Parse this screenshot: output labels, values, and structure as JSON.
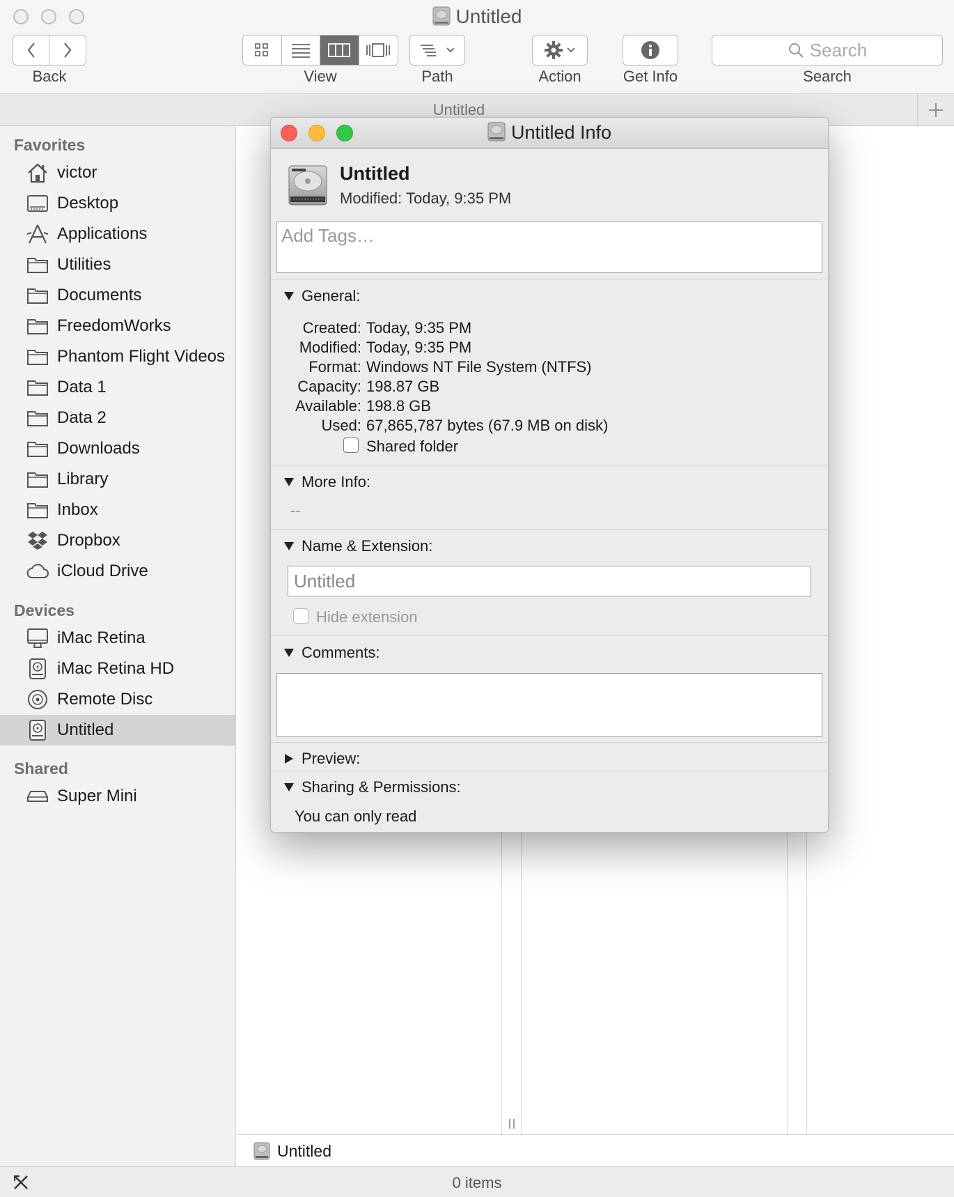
{
  "window": {
    "title": "Untitled"
  },
  "toolbar": {
    "back_label": "Back",
    "view_label": "View",
    "path_label": "Path",
    "action_label": "Action",
    "getinfo_label": "Get Info",
    "search_label": "Search",
    "search_placeholder": "Search"
  },
  "tabbar": {
    "title": "Untitled"
  },
  "sidebar": {
    "favorites_heading": "Favorites",
    "favorites": [
      {
        "label": "victor",
        "icon": "home-icon"
      },
      {
        "label": "Desktop",
        "icon": "desktop-icon"
      },
      {
        "label": "Applications",
        "icon": "applications-icon"
      },
      {
        "label": "Utilities",
        "icon": "folder-icon"
      },
      {
        "label": "Documents",
        "icon": "folder-icon"
      },
      {
        "label": "FreedomWorks",
        "icon": "folder-icon"
      },
      {
        "label": "Phantom Flight Videos",
        "icon": "folder-icon"
      },
      {
        "label": "Data 1",
        "icon": "folder-icon"
      },
      {
        "label": "Data 2",
        "icon": "folder-icon"
      },
      {
        "label": "Downloads",
        "icon": "folder-icon"
      },
      {
        "label": "Library",
        "icon": "folder-icon"
      },
      {
        "label": "Inbox",
        "icon": "folder-icon"
      },
      {
        "label": "Dropbox",
        "icon": "dropbox-icon"
      },
      {
        "label": "iCloud Drive",
        "icon": "cloud-icon"
      }
    ],
    "devices_heading": "Devices",
    "devices": [
      {
        "label": "iMac Retina",
        "icon": "imac-icon"
      },
      {
        "label": "iMac Retina HD",
        "icon": "hard-drive-icon"
      },
      {
        "label": "Remote Disc",
        "icon": "disc-icon"
      },
      {
        "label": "Untitled",
        "icon": "hard-drive-icon",
        "selected": true
      }
    ],
    "shared_heading": "Shared",
    "shared": [
      {
        "label": "Super Mini",
        "icon": "mac-mini-icon"
      }
    ]
  },
  "pathbar": {
    "label": "Untitled"
  },
  "statusbar": {
    "count": "0 items"
  },
  "info": {
    "title": "Untitled Info",
    "name": "Untitled",
    "modified_header": "Modified: Today, 9:35 PM",
    "tags_placeholder": "Add Tags…",
    "general": {
      "heading": "General:",
      "rows": [
        {
          "key": "Created:",
          "value": "Today, 9:35 PM"
        },
        {
          "key": "Modified:",
          "value": "Today, 9:35 PM"
        },
        {
          "key": "Format:",
          "value": "Windows NT File System (NTFS)"
        },
        {
          "key": "Capacity:",
          "value": "198.87 GB"
        },
        {
          "key": "Available:",
          "value": "198.8 GB"
        },
        {
          "key": "Used:",
          "value": "67,865,787 bytes (67.9 MB on disk)"
        }
      ],
      "shared_folder_label": "Shared folder"
    },
    "more_info": {
      "heading": "More Info:",
      "value": "--"
    },
    "name_extension": {
      "heading": "Name & Extension:",
      "name_value": "Untitled",
      "hide_extension_label": "Hide extension"
    },
    "comments": {
      "heading": "Comments:"
    },
    "preview": {
      "heading": "Preview:"
    },
    "sharing": {
      "heading": "Sharing & Permissions:",
      "value": "You can only read"
    }
  },
  "colors": {
    "close": "#fc605c",
    "minimize": "#fdbc40",
    "zoom": "#34c84a",
    "selected_sidebar": "#d4d4d4"
  }
}
